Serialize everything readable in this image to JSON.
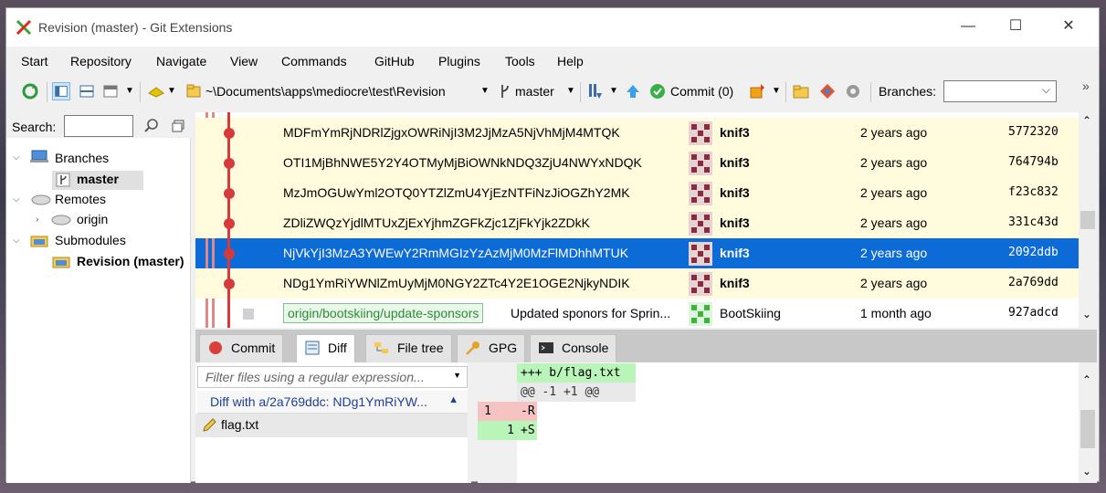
{
  "window": {
    "title": "Revision (master) - Git Extensions",
    "minimize": "—",
    "maximize": "☐",
    "close": "✕"
  },
  "menu": [
    "Start",
    "Repository",
    "Navigate",
    "View",
    "Commands",
    "GitHub",
    "Plugins",
    "Tools",
    "Help"
  ],
  "toolbar": {
    "repo_path": "~\\Documents\\apps\\mediocre\\test\\Revision",
    "branch": "master",
    "commit_label": "Commit (0)",
    "branches_label": "Branches:",
    "overflow": "»"
  },
  "left_panel": {
    "search_label": "Search:",
    "tree": {
      "branches": "Branches",
      "master": "master",
      "remotes": "Remotes",
      "origin": "origin",
      "submodules": "Submodules",
      "revision": "Revision (master)"
    }
  },
  "commits": [
    {
      "message": "MDFmYmRjNDRlZjgxOWRiNjI3M2JjMzA5NjVhMjM4MTQK",
      "author": "knif3",
      "date": "2 years ago",
      "sha": "5772320",
      "state": "normal"
    },
    {
      "message": "OTI1MjBhNWE5Y2Y4OTMyMjBiOWNkNDQ3ZjU4NWYxNDQK",
      "author": "knif3",
      "date": "2 years ago",
      "sha": "764794b",
      "state": "normal"
    },
    {
      "message": "MzJmOGUwYml2OTQ0YTZlZmU4YjEzNTFiNzJiOGZhY2MK",
      "author": "knif3",
      "date": "2 years ago",
      "sha": "f23c832",
      "state": "normal"
    },
    {
      "message": "ZDliZWQzYjdlMTUxZjExYjhmZGFkZjc1ZjFkYjk2ZDkK",
      "author": "knif3",
      "date": "2 years ago",
      "sha": "331c43d",
      "state": "normal"
    },
    {
      "message": "NjVkYjI3MzA3YWEwY2RmMGIzYzAzMjM0MzFlMDhhMTUK",
      "author": "knif3",
      "date": "2 years ago",
      "sha": "2092ddb",
      "state": "selected"
    },
    {
      "message": "NDg1YmRiYWNlZmUyMjM0NGY2ZTc4Y2E1OGE2NjkyNDIK",
      "author": "knif3",
      "date": "2 years ago",
      "sha": "2a769dd",
      "state": "normal"
    },
    {
      "branch": "origin/bootskiing/update-sponsors",
      "message": "Updated sponors for Sprin...",
      "author": "BootSkiing",
      "date": "1 month ago",
      "sha": "927adcd",
      "state": "other"
    }
  ],
  "tabs": [
    "Commit",
    "Diff",
    "File tree",
    "GPG",
    "Console"
  ],
  "diff": {
    "filter_placeholder": "Filter files using a regular expression...",
    "diff_with": "Diff with a/2a769ddc: NDg1YmRiYW...",
    "file": "flag.txt",
    "lines": [
      {
        "old": "",
        "new": "",
        "text": "+++ b/flag.txt",
        "kind": "header"
      },
      {
        "old": "",
        "new": "",
        "text": "@@ -1 +1 @@",
        "kind": "hunk"
      },
      {
        "old": "1",
        "new": "",
        "text": "-R",
        "kind": "removed"
      },
      {
        "old": "",
        "new": "1",
        "text": "+S",
        "kind": "added"
      }
    ]
  },
  "colors": {
    "graph_red": "#d63a3a",
    "selected": "#0d6bd7",
    "row_highlight": "#fffbdc",
    "added": "#b9f4b9",
    "removed": "#f6c3c3"
  }
}
